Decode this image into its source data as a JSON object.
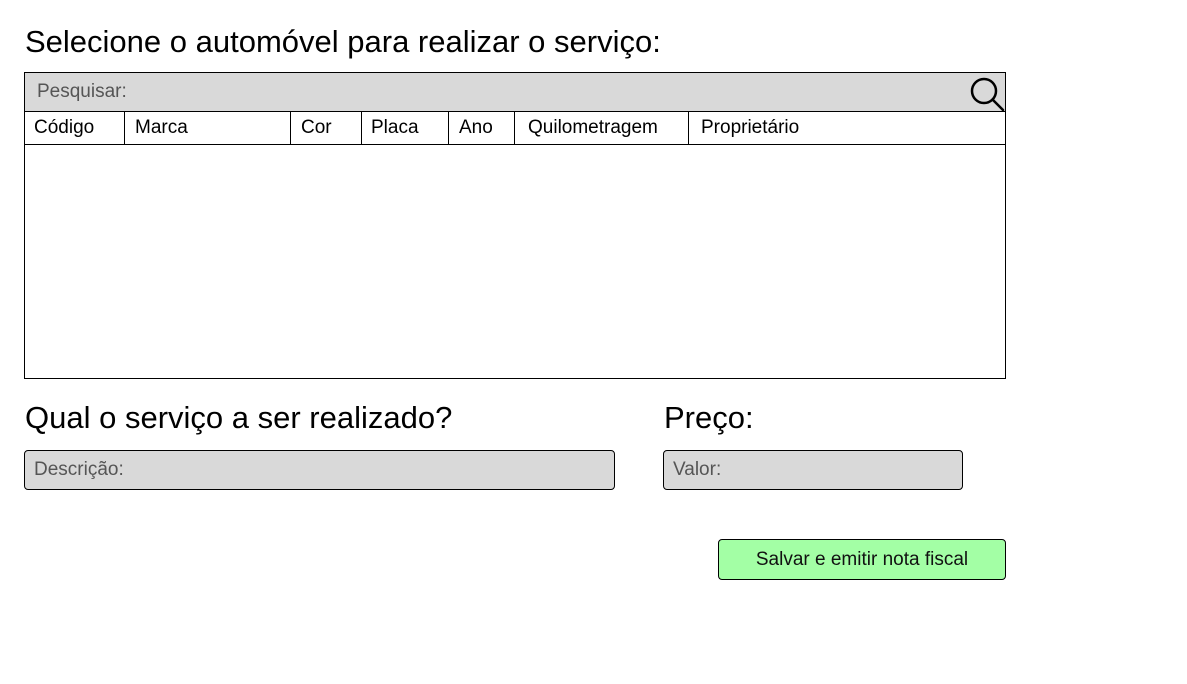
{
  "vehicle_section": {
    "heading": "Selecione o automóvel para realizar o serviço:",
    "search": {
      "placeholder": "Pesquisar:",
      "value": "",
      "icon": "search-icon"
    },
    "columns": [
      "Código",
      "Marca",
      "Cor",
      "Placa",
      "Ano",
      "Quilometragem",
      "Proprietário"
    ],
    "rows": []
  },
  "service_section": {
    "heading": "Qual o serviço a ser realizado?",
    "description": {
      "placeholder": "Descrição:",
      "value": ""
    }
  },
  "price_section": {
    "heading": "Preço:",
    "value": {
      "placeholder": "Valor:",
      "value": ""
    }
  },
  "actions": {
    "save_label": "Salvar e emitir nota fiscal"
  },
  "colors": {
    "field_background": "#d9d9d9",
    "save_button_background": "#a3ffa5",
    "border": "#000000"
  }
}
